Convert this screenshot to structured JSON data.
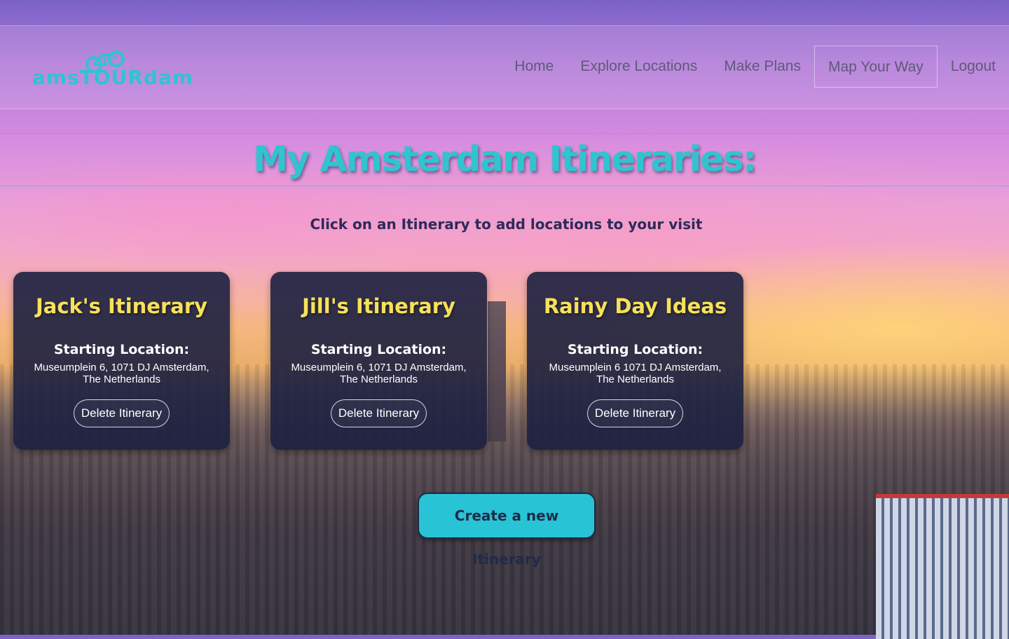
{
  "brand": {
    "logo_text": "amsTOURdam",
    "logo_icon": "bicycle-icon",
    "accent": "#2fc4d0"
  },
  "nav": {
    "items": [
      {
        "label": "Home"
      },
      {
        "label": "Explore Locations"
      },
      {
        "label": "Make Plans"
      },
      {
        "label": "Map Your Way",
        "active": true
      },
      {
        "label": "Logout"
      }
    ]
  },
  "main": {
    "title": "My Amsterdam Itineraries:",
    "subtitle": "Click on an Itinerary to add locations to your visit",
    "itineraries": [
      {
        "name": "Jack's Itinerary",
        "start_label": "Starting Location:",
        "address": "Museumplein 6, 1071 DJ Amsterdam, The Netherlands",
        "delete_label": "Delete Itinerary"
      },
      {
        "name": "Jill's Itinerary",
        "start_label": "Starting Location:",
        "address": "Museumplein 6, 1071 DJ Amsterdam, The Netherlands",
        "delete_label": "Delete Itinerary"
      },
      {
        "name": "Rainy Day Ideas",
        "start_label": "Starting Location:",
        "address": "Museumplein 6 1071 DJ Amsterdam, The Netherlands",
        "delete_label": "Delete Itinerary"
      }
    ],
    "create_label": "Create a new Itinerary"
  },
  "colors": {
    "card_title": "#f7e15a",
    "card_bg": "#1c2040",
    "create_button": "#29c3d6",
    "subtitle": "#2e2a5a"
  }
}
